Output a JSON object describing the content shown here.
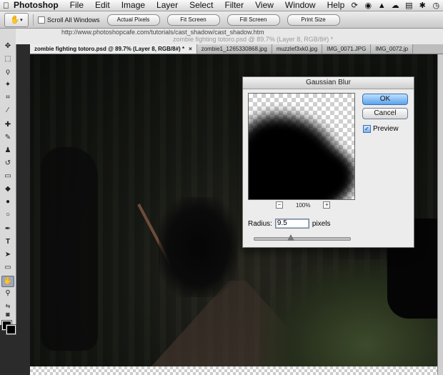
{
  "menubar": {
    "apple": "",
    "items": [
      "Photoshop",
      "File",
      "Edit",
      "Image",
      "Layer",
      "Select",
      "Filter",
      "View",
      "Window",
      "Help"
    ]
  },
  "options": {
    "tool_icon": "hand-icon",
    "scroll_all_label": "Scroll All Windows",
    "buttons": [
      "Actual Pixels",
      "Fit Screen",
      "Fill Screen",
      "Print Size"
    ]
  },
  "background_window": {
    "url": "http://www.photoshopcafe.com/tutorials/cast_shadow/cast_shadow.htm",
    "title": "zombie fighting totoro.psd @ 89.7% (Layer 8, RGB/8#) *"
  },
  "tabs": [
    {
      "label": "zombie fighting totoro.psd @ 89.7% (Layer 8, RGB/8#) *",
      "close": "×"
    },
    {
      "label": "zombie1_1265330868.jpg"
    },
    {
      "label": "muzzlef3xk0.jpg"
    },
    {
      "label": "IMG_0071.JPG"
    },
    {
      "label": "IMG_0072.jp"
    }
  ],
  "dialog": {
    "title": "Gaussian Blur",
    "ok": "OK",
    "cancel": "Cancel",
    "preview_label": "Preview",
    "preview_checked": true,
    "zoom_minus": "−",
    "zoom_value": "100%",
    "zoom_plus": "+",
    "radius_label": "Radius:",
    "radius_value": "9.5",
    "radius_unit": "pixels",
    "slider_fraction": 0.38
  },
  "colors": {
    "foreground": "#000000",
    "background": "#000000",
    "ok_accent": "#5aa3ec"
  }
}
